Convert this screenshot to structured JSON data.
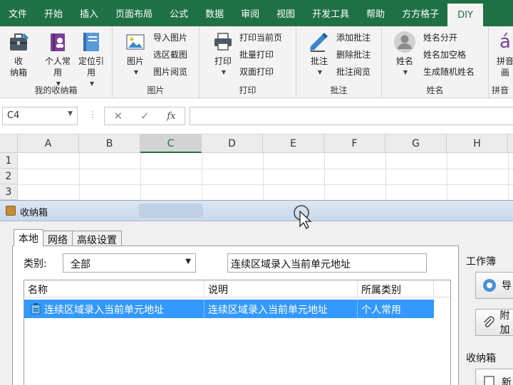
{
  "ribbon": {
    "tabs": [
      "文件",
      "开始",
      "插入",
      "页面布局",
      "公式",
      "数据",
      "审阅",
      "视图",
      "开发工具",
      "帮助",
      "方方格子",
      "DIY"
    ],
    "groups": {
      "toolbox": {
        "label": "我的收纳箱",
        "buttons": [
          "收\n纳箱",
          "个人常\n用",
          "定位引\n用"
        ]
      },
      "picture": {
        "label": "图片",
        "big": "图片",
        "small": [
          "导入图片",
          "选区截图",
          "图片阅览"
        ]
      },
      "print": {
        "label": "打印",
        "big": "打印",
        "small": [
          "打印当前页",
          "批量打印",
          "双面打印"
        ]
      },
      "comment": {
        "label": "批注",
        "big": "批注",
        "small": [
          "添加批注",
          "删除批注",
          "批注阅览"
        ]
      },
      "name": {
        "label": "姓名",
        "big": "姓名",
        "small": [
          "姓名分开",
          "姓名加空格",
          "生成随机姓名"
        ]
      },
      "pinyin": {
        "label": "拼音",
        "big": "拼音\n画",
        "glyph": "á"
      }
    }
  },
  "formula_bar": {
    "name_box": "C4",
    "fx_label": "fx"
  },
  "grid": {
    "columns": [
      "A",
      "B",
      "C",
      "D",
      "E",
      "F",
      "G",
      "H"
    ],
    "rows": [
      "1",
      "2",
      "3"
    ],
    "selected_column": "C"
  },
  "dialog": {
    "title": "收纳箱",
    "tabs": [
      "本地",
      "网络",
      "高级设置"
    ],
    "category_label": "类别:",
    "category_value": "全部",
    "search_value": "连续区域录入当前单元地址",
    "list": {
      "headers": [
        "名称",
        "说明",
        "所属类别"
      ],
      "rows": [
        {
          "name": "连续区域录入当前单元地址",
          "desc": "连续区域录入当前单元地址",
          "category": "个人常用"
        }
      ]
    },
    "side": {
      "workbook_label": "工作簿",
      "btn1_label": "导",
      "btn2_label": "附加",
      "toolbox_label": "收纳箱",
      "btn3_label": "新"
    }
  },
  "colors": {
    "ribbon_green": "#1f7145",
    "selection_blue": "#3399ff"
  }
}
